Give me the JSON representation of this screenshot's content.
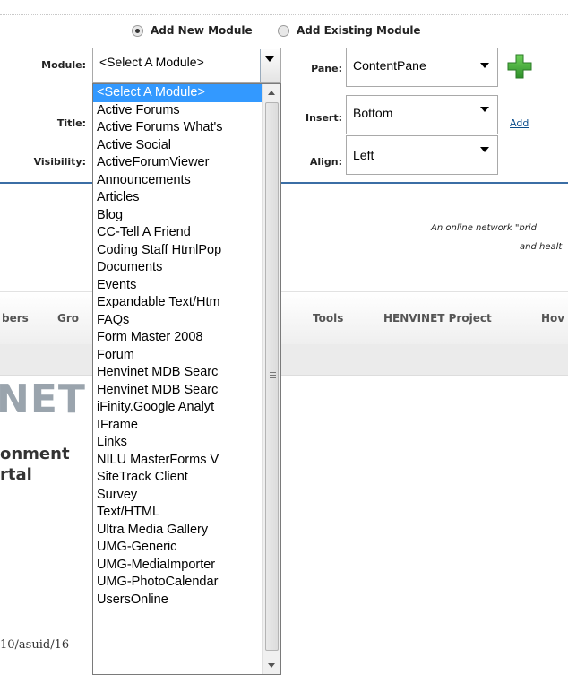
{
  "radio": {
    "add_new_label": "Add New Module",
    "add_existing_label": "Add Existing Module",
    "selected": "add_new"
  },
  "form": {
    "module_label": "Module:",
    "title_label": "Title:",
    "visibility_label": "Visibility:",
    "pane_label": "Pane:",
    "insert_label": "Insert:",
    "align_label": "Align:",
    "module_value": "<Select A Module>",
    "pane_value": "ContentPane",
    "insert_value": "Bottom",
    "align_value": "Left",
    "add_link": "Add",
    "add_icon": "plus-icon"
  },
  "module_list": [
    "<Select A Module>",
    "Active Forums",
    "Active Forums What's",
    "Active Social",
    "ActiveForumViewer",
    "Announcements",
    "Articles",
    "Blog",
    "CC-Tell A Friend",
    "Coding Staff HtmlPop",
    "Documents",
    "Events",
    "Expandable Text/Htm",
    "FAQs",
    "Form Master 2008",
    "Forum",
    "Henvinet MDB Searc",
    "Henvinet MDB Searc",
    "iFinity.Google Analyt",
    "IFrame",
    "Links",
    "NILU MasterForms V",
    "SiteTrack Client",
    "Survey",
    "Text/HTML",
    "Ultra Media Gallery",
    "UMG-Generic",
    "UMG-MediaImporter",
    "UMG-PhotoCalendar",
    "UsersOnline"
  ],
  "page": {
    "tagline_line1": "An online network \"brid",
    "tagline_line2": "and healt",
    "nav": [
      "bers",
      "Gro",
      "Tools",
      "HENVINET Project",
      "Hov"
    ],
    "logo_text": "NET",
    "logo_sub1": "onment",
    "logo_sub2": "rtal",
    "bottom_text": "10/asuid/16"
  },
  "colors": {
    "selection": "#3399ff",
    "link": "#0a4d8c",
    "divider": "#3b6ea5",
    "plus_icon": "#3aa635"
  }
}
